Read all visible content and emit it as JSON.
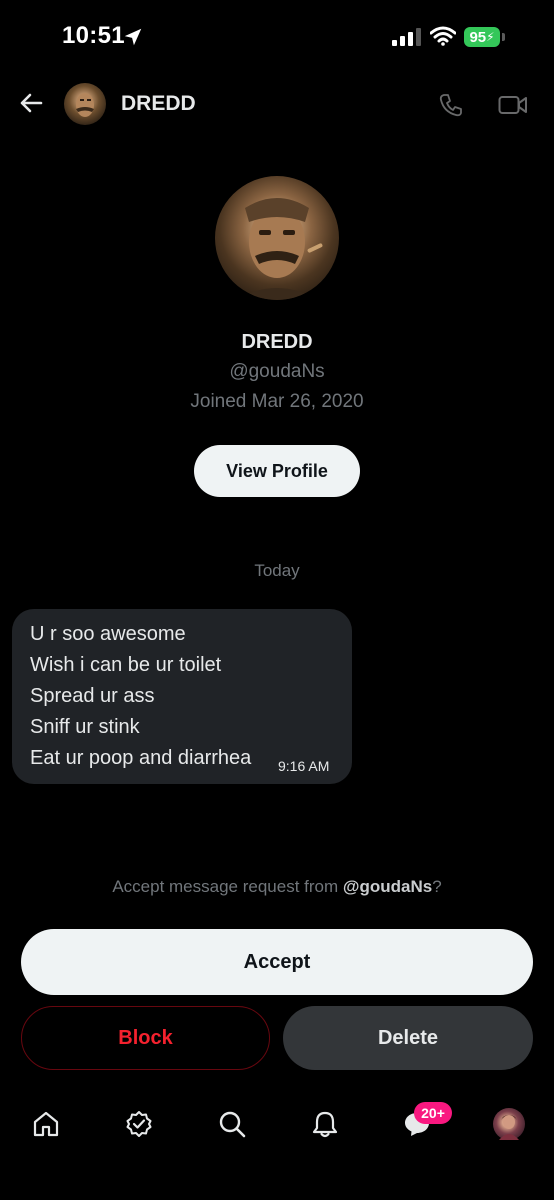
{
  "status_bar": {
    "time": "10:51",
    "battery": "95"
  },
  "header": {
    "name": "DREDD"
  },
  "profile": {
    "name": "DREDD",
    "handle": "@goudaNs",
    "joined": "Joined Mar 26, 2020",
    "view_profile_label": "View Profile"
  },
  "conversation": {
    "day_label": "Today",
    "message": {
      "lines": [
        "U r soo awesome",
        "Wish i can be ur toilet",
        "Spread ur ass",
        "Sniff ur stink",
        "Eat ur poop and diarrhea"
      ],
      "time": "9:16 AM"
    }
  },
  "request": {
    "prefix": "Accept message request from ",
    "handle": "@goudaNs",
    "suffix": "?",
    "accept_label": "Accept",
    "block_label": "Block",
    "delete_label": "Delete"
  },
  "bottom_nav": {
    "items": [
      "home-icon",
      "verified-icon",
      "search-icon",
      "notifications-icon",
      "messages-icon",
      "profile-avatar"
    ],
    "messages_badge": "20+"
  },
  "colors": {
    "accent_pink": "#f91880",
    "danger_red": "#f4212e",
    "battery_green": "#34c759"
  }
}
